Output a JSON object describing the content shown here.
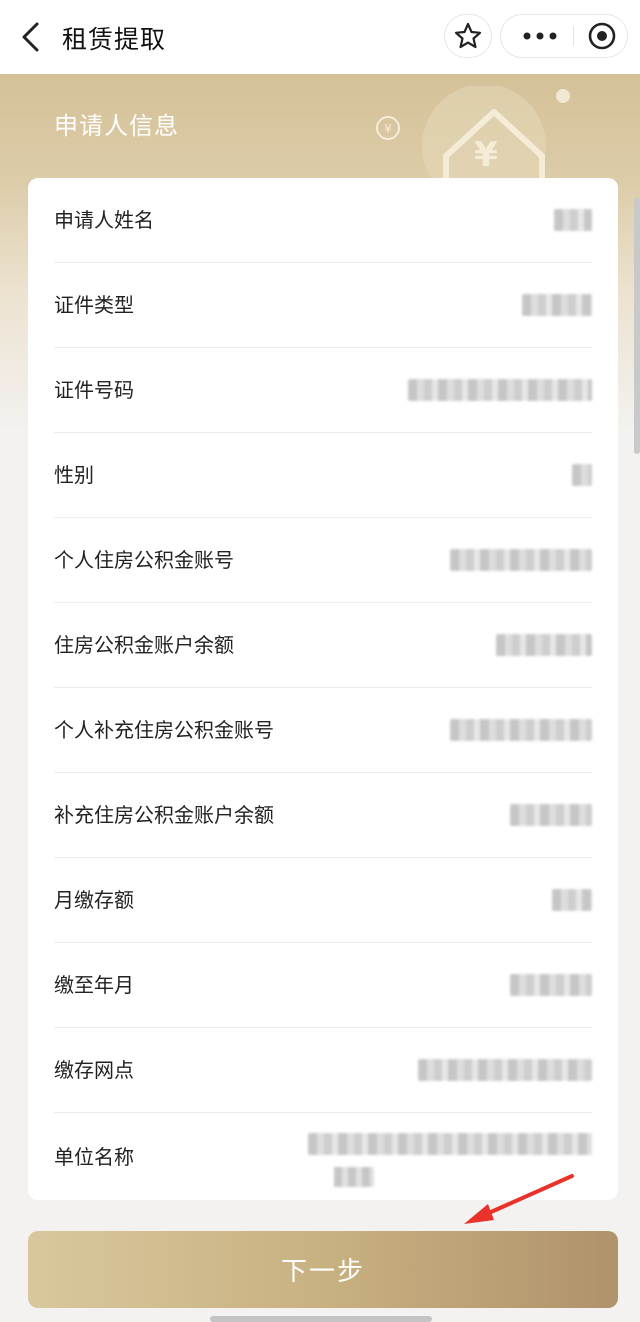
{
  "nav": {
    "title": "租赁提取",
    "back_icon": "chevron-left-icon",
    "favorite_icon": "star-icon",
    "more_icon": "more-dots-icon",
    "close_icon": "target-circle-icon"
  },
  "header": {
    "section_title": "申请人信息"
  },
  "fields": [
    {
      "label": "申请人姓名",
      "value": "██"
    },
    {
      "label": "证件类型",
      "value": "████"
    },
    {
      "label": "证件号码",
      "value": "██████████████████"
    },
    {
      "label": "性别",
      "value": "█"
    },
    {
      "label": "个人住房公积金账号",
      "value": "████████████"
    },
    {
      "label": "住房公积金账户余额",
      "value": "████████"
    },
    {
      "label": "个人补充住房公积金账号",
      "value": "████████████"
    },
    {
      "label": "补充住房公积金账户余额",
      "value": "██████"
    },
    {
      "label": "月缴存额",
      "value": "███"
    },
    {
      "label": "缴至年月",
      "value": "██████"
    },
    {
      "label": "缴存网点",
      "value": "████████████████"
    },
    {
      "label": "单位名称",
      "value": "██████████████████"
    }
  ],
  "next_button": {
    "label": "下一步"
  },
  "colors": {
    "accent_gold": "#c8b181",
    "button_gradient_end": "#b0926b",
    "arrow_red": "#e8322a"
  }
}
